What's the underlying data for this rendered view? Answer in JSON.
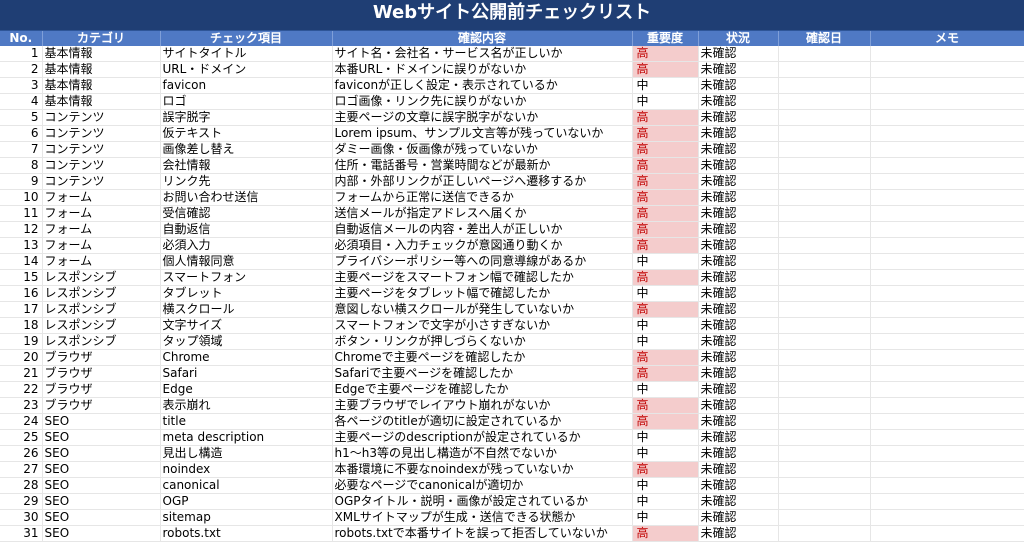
{
  "title": "Webサイト公開前チェックリスト",
  "headers": [
    "No.",
    "カテゴリ",
    "チェック項目",
    "確認内容",
    "重要度",
    "状況",
    "確認日",
    "メモ"
  ],
  "rows": [
    {
      "no": "1",
      "cat": "基本情報",
      "item": "サイトタイトル",
      "content": "サイト名・会社名・サービス名が正しいか",
      "imp": "高",
      "status": "未確認"
    },
    {
      "no": "2",
      "cat": "基本情報",
      "item": "URL・ドメイン",
      "content": "本番URL・ドメインに誤りがないか",
      "imp": "高",
      "status": "未確認"
    },
    {
      "no": "3",
      "cat": "基本情報",
      "item": "favicon",
      "content": "faviconが正しく設定・表示されているか",
      "imp": "中",
      "status": "未確認"
    },
    {
      "no": "4",
      "cat": "基本情報",
      "item": "ロゴ",
      "content": "ロゴ画像・リンク先に誤りがないか",
      "imp": "中",
      "status": "未確認"
    },
    {
      "no": "5",
      "cat": "コンテンツ",
      "item": "誤字脱字",
      "content": "主要ページの文章に誤字脱字がないか",
      "imp": "高",
      "status": "未確認"
    },
    {
      "no": "6",
      "cat": "コンテンツ",
      "item": "仮テキスト",
      "content": "Lorem ipsum、サンプル文言等が残っていないか",
      "imp": "高",
      "status": "未確認"
    },
    {
      "no": "7",
      "cat": "コンテンツ",
      "item": "画像差し替え",
      "content": "ダミー画像・仮画像が残っていないか",
      "imp": "高",
      "status": "未確認"
    },
    {
      "no": "8",
      "cat": "コンテンツ",
      "item": "会社情報",
      "content": "住所・電話番号・営業時間などが最新か",
      "imp": "高",
      "status": "未確認"
    },
    {
      "no": "9",
      "cat": "コンテンツ",
      "item": "リンク先",
      "content": "内部・外部リンクが正しいページへ遷移するか",
      "imp": "高",
      "status": "未確認"
    },
    {
      "no": "10",
      "cat": "フォーム",
      "item": "お問い合わせ送信",
      "content": "フォームから正常に送信できるか",
      "imp": "高",
      "status": "未確認"
    },
    {
      "no": "11",
      "cat": "フォーム",
      "item": "受信確認",
      "content": "送信メールが指定アドレスへ届くか",
      "imp": "高",
      "status": "未確認"
    },
    {
      "no": "12",
      "cat": "フォーム",
      "item": "自動返信",
      "content": "自動返信メールの内容・差出人が正しいか",
      "imp": "高",
      "status": "未確認"
    },
    {
      "no": "13",
      "cat": "フォーム",
      "item": "必須入力",
      "content": "必須項目・入力チェックが意図通り動くか",
      "imp": "高",
      "status": "未確認"
    },
    {
      "no": "14",
      "cat": "フォーム",
      "item": "個人情報同意",
      "content": "プライバシーポリシー等への同意導線があるか",
      "imp": "中",
      "status": "未確認"
    },
    {
      "no": "15",
      "cat": "レスポンシブ",
      "item": "スマートフォン",
      "content": "主要ページをスマートフォン幅で確認したか",
      "imp": "高",
      "status": "未確認"
    },
    {
      "no": "16",
      "cat": "レスポンシブ",
      "item": "タブレット",
      "content": "主要ページをタブレット幅で確認したか",
      "imp": "中",
      "status": "未確認"
    },
    {
      "no": "17",
      "cat": "レスポンシブ",
      "item": "横スクロール",
      "content": "意図しない横スクロールが発生していないか",
      "imp": "高",
      "status": "未確認"
    },
    {
      "no": "18",
      "cat": "レスポンシブ",
      "item": "文字サイズ",
      "content": "スマートフォンで文字が小さすぎないか",
      "imp": "中",
      "status": "未確認"
    },
    {
      "no": "19",
      "cat": "レスポンシブ",
      "item": "タップ領域",
      "content": "ボタン・リンクが押しづらくないか",
      "imp": "中",
      "status": "未確認"
    },
    {
      "no": "20",
      "cat": "ブラウザ",
      "item": "Chrome",
      "content": "Chromeで主要ページを確認したか",
      "imp": "高",
      "status": "未確認"
    },
    {
      "no": "21",
      "cat": "ブラウザ",
      "item": "Safari",
      "content": "Safariで主要ページを確認したか",
      "imp": "高",
      "status": "未確認"
    },
    {
      "no": "22",
      "cat": "ブラウザ",
      "item": "Edge",
      "content": "Edgeで主要ページを確認したか",
      "imp": "中",
      "status": "未確認"
    },
    {
      "no": "23",
      "cat": "ブラウザ",
      "item": "表示崩れ",
      "content": "主要ブラウザでレイアウト崩れがないか",
      "imp": "高",
      "status": "未確認"
    },
    {
      "no": "24",
      "cat": "SEO",
      "item": "title",
      "content": "各ページのtitleが適切に設定されているか",
      "imp": "高",
      "status": "未確認"
    },
    {
      "no": "25",
      "cat": "SEO",
      "item": "meta description",
      "content": "主要ページのdescriptionが設定されているか",
      "imp": "中",
      "status": "未確認"
    },
    {
      "no": "26",
      "cat": "SEO",
      "item": "見出し構造",
      "content": "h1〜h3等の見出し構造が不自然でないか",
      "imp": "中",
      "status": "未確認"
    },
    {
      "no": "27",
      "cat": "SEO",
      "item": "noindex",
      "content": "本番環境に不要なnoindexが残っていないか",
      "imp": "高",
      "status": "未確認"
    },
    {
      "no": "28",
      "cat": "SEO",
      "item": "canonical",
      "content": "必要なページでcanonicalが適切か",
      "imp": "中",
      "status": "未確認"
    },
    {
      "no": "29",
      "cat": "SEO",
      "item": "OGP",
      "content": "OGPタイトル・説明・画像が設定されているか",
      "imp": "中",
      "status": "未確認"
    },
    {
      "no": "30",
      "cat": "SEO",
      "item": "sitemap",
      "content": "XMLサイトマップが生成・送信できる状態か",
      "imp": "中",
      "status": "未確認"
    },
    {
      "no": "31",
      "cat": "SEO",
      "item": "robots.txt",
      "content": "robots.txtで本番サイトを誤って拒否していないか",
      "imp": "高",
      "status": "未確認"
    }
  ],
  "colors": {
    "title_bg": "#1f3e74",
    "header_bg": "#4f79c4",
    "high_bg": "#f4cccc",
    "high_text": "#c00000"
  }
}
